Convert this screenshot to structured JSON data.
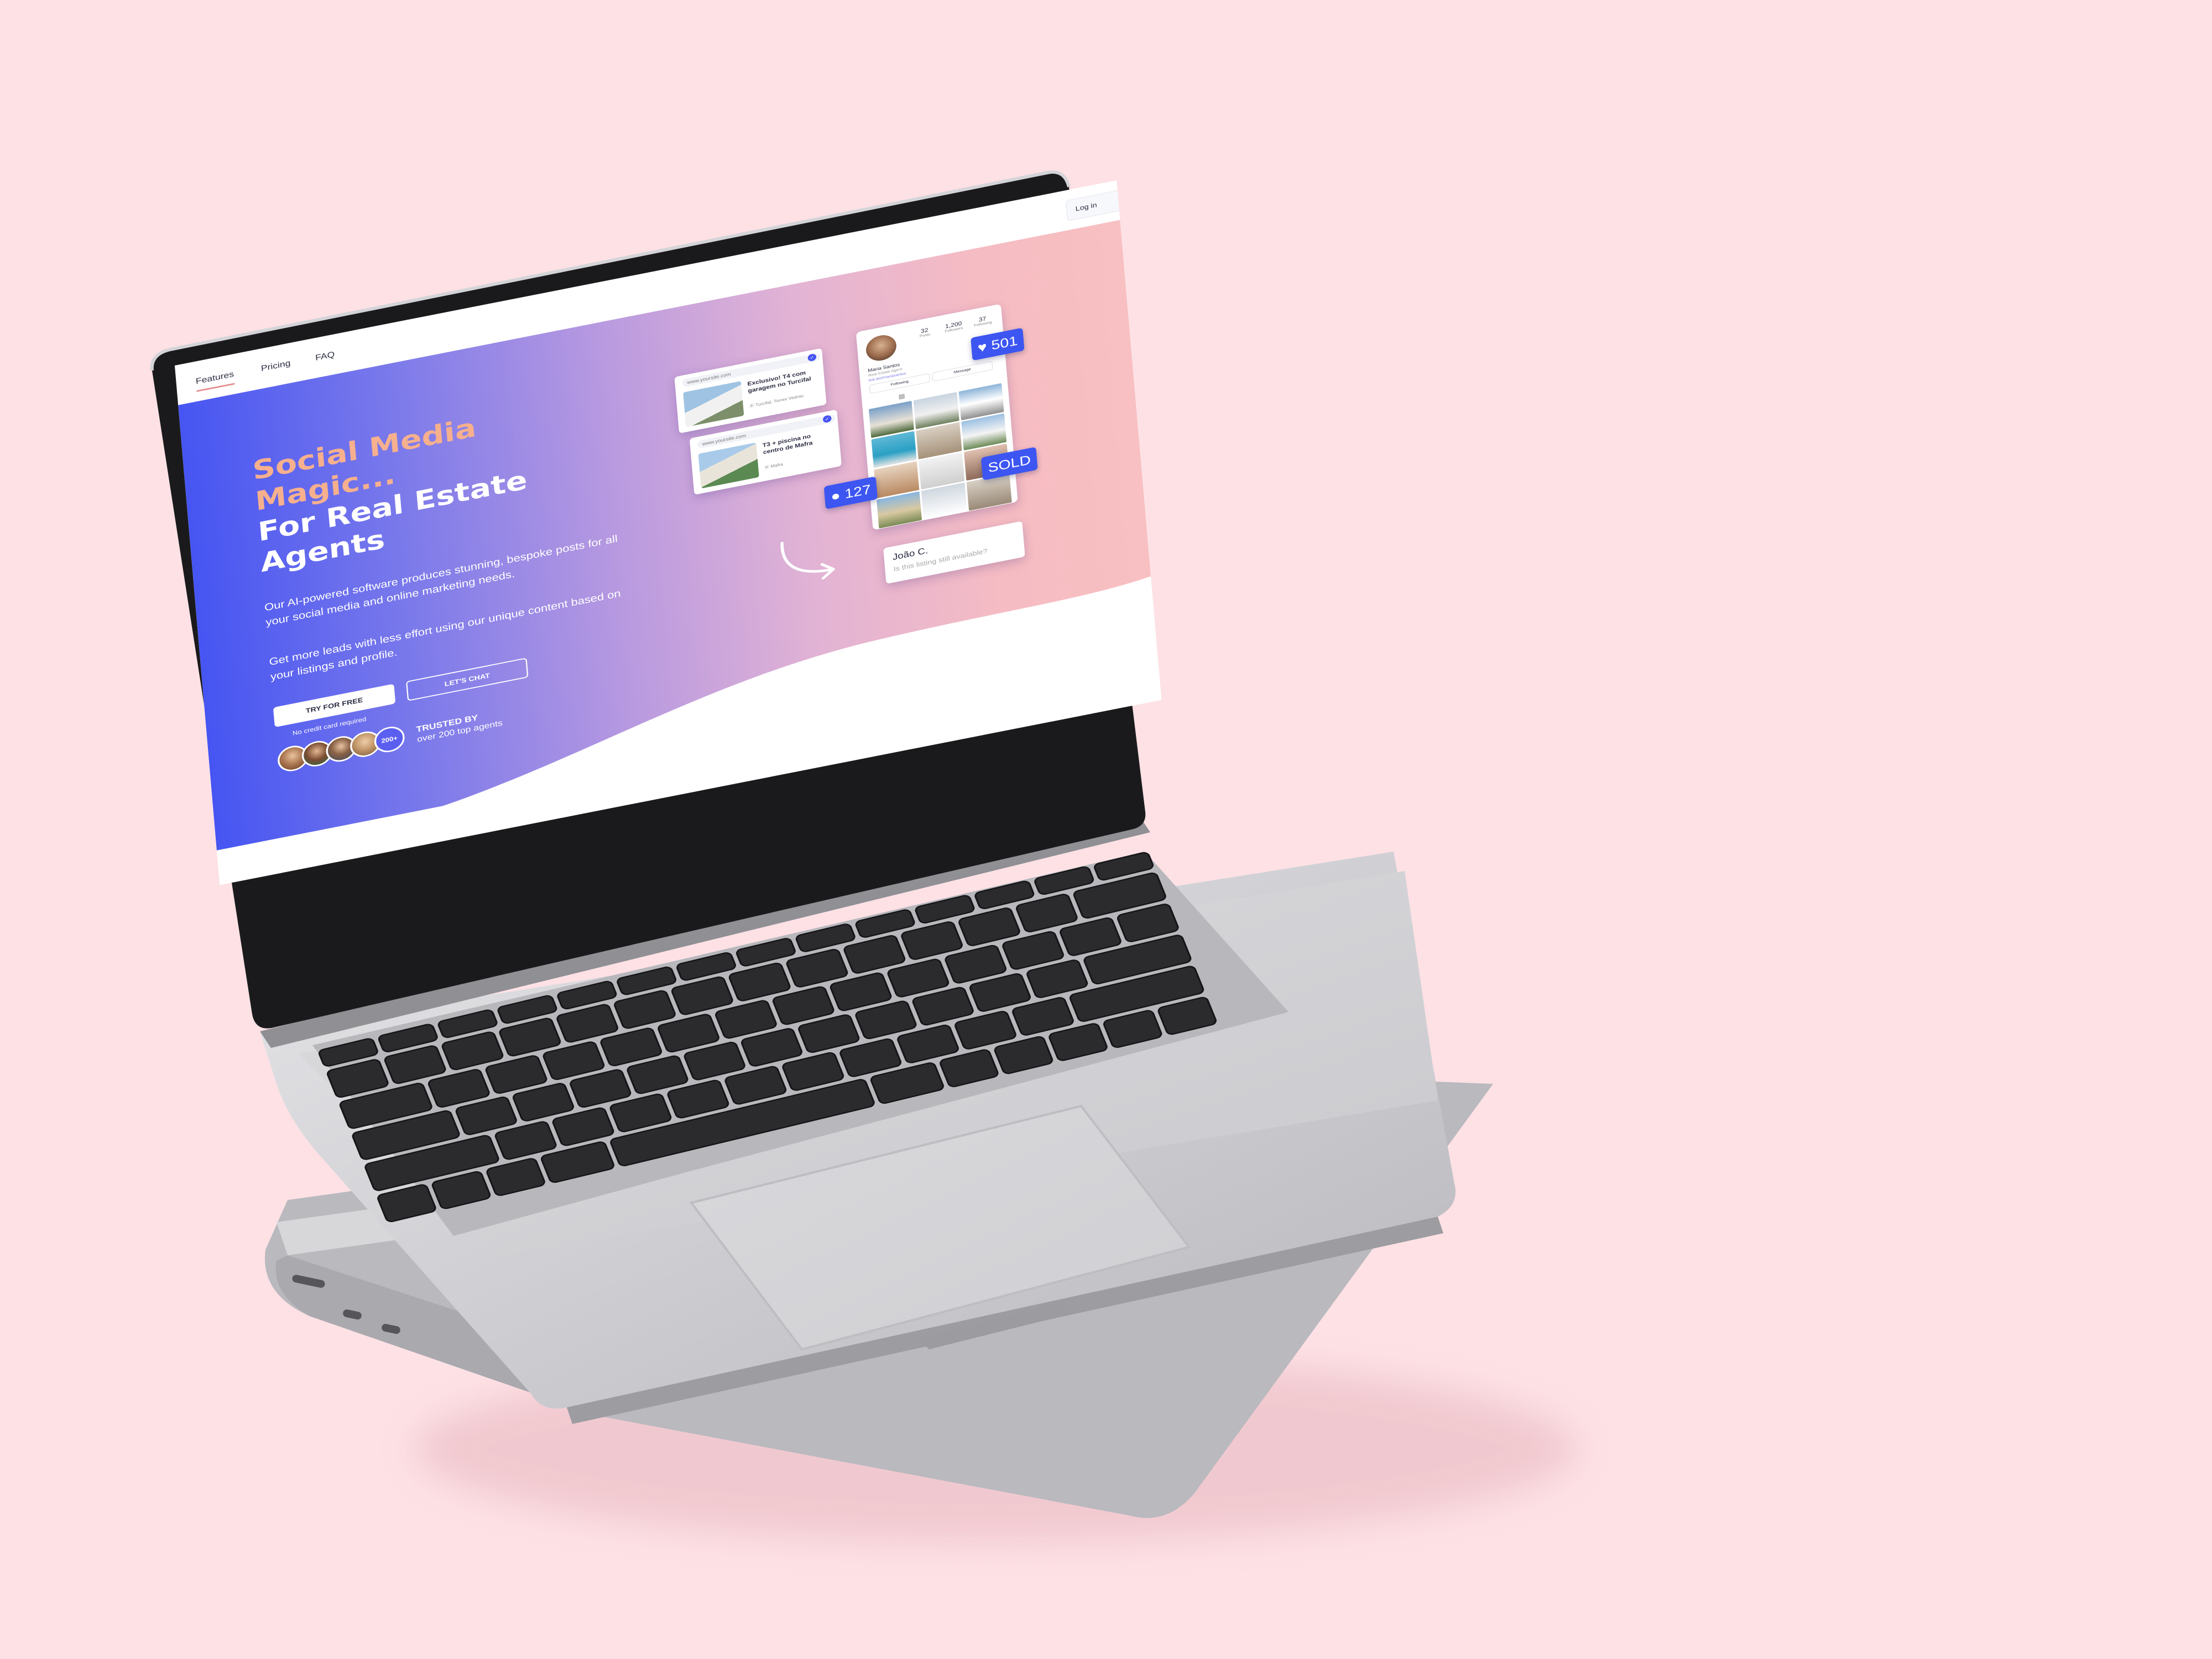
{
  "nav": {
    "items": [
      "Features",
      "Pricing",
      "FAQ"
    ],
    "login": "Log in"
  },
  "hero": {
    "title_line1": "Social Media",
    "title_line2": "Magic",
    "title_dots": "...",
    "title_line3": "For Real Estate",
    "title_line4": "Agents",
    "para1": "Our AI-powered software produces stunning, bespoke posts for all your social media and online marketing needs.",
    "para2": "Get more leads with less effort using our unique content based on your listings and profile.",
    "cta_primary": "TRY FOR FREE",
    "cta_secondary": "LET'S CHAT",
    "note": "No credit card required",
    "avatar_count": "200+",
    "trusted_title": "TRUSTED BY",
    "trusted_sub": "over 200 top agents"
  },
  "listing_cards": [
    {
      "url": "www.yoursite.com",
      "title": "Exclusivo! T4 com garagem no Turcifal",
      "location": "Turcifal, Torres Vedras"
    },
    {
      "url": "www.yoursite.com",
      "title": "T3 + piscina no centro de Mafra",
      "location": "Mafra"
    }
  ],
  "profile": {
    "posts": "32",
    "posts_label": "Posts",
    "followers": "1,200",
    "followers_label": "Followers",
    "following": "37",
    "following_label": "Following",
    "name": "Maria Santos",
    "role": "Real Estate Agent",
    "link": "link.bio/mariasantos",
    "btn_following": "Following",
    "btn_message": "Message"
  },
  "badges": {
    "likes": "501",
    "comments": "127",
    "sold": "SOLD"
  },
  "comment": {
    "name": "João C.",
    "text": "Is this listing still available?"
  },
  "colors": {
    "background": "#fde1e5",
    "gradient_start": "#4655f2",
    "gradient_end": "#f8c0c2",
    "accent_peach": "#f6b08e",
    "badge_blue": "#3d56f2"
  },
  "icons": [
    "heart-icon",
    "chat-bubble-icon",
    "check-icon",
    "location-pin-icon",
    "grid-icon",
    "curved-arrow-icon"
  ]
}
